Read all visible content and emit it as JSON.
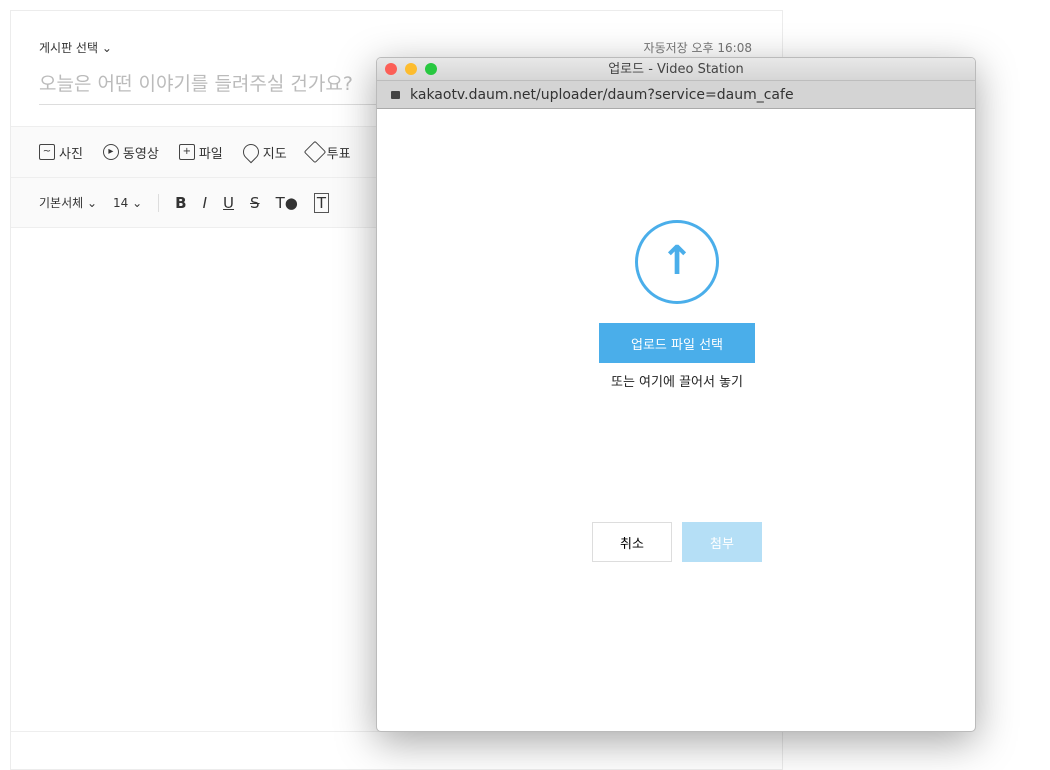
{
  "editor": {
    "board_select": "게시판 선택 ⌄",
    "autosave": "자동저장 오후 16:08",
    "title_placeholder": "오늘은 어떤 이야기를 들려주실 건가요?",
    "insert_toolbar": [
      {
        "label": "사진",
        "icon": "image-icon"
      },
      {
        "label": "동영상",
        "icon": "play-icon"
      },
      {
        "label": "파일",
        "icon": "file-plus-icon"
      },
      {
        "label": "지도",
        "icon": "map-pin-icon"
      },
      {
        "label": "투표",
        "icon": "vote-icon"
      }
    ],
    "font_family": "기본서체 ⌄",
    "font_size": "14  ⌄",
    "format": {
      "bold": "B",
      "italic": "I",
      "underline": "U",
      "strike": "S",
      "color": "T●",
      "bg": "T"
    }
  },
  "popup": {
    "title": "업로드 - Video Station",
    "url": "kakaotv.daum.net/uploader/daum?service=daum_cafe",
    "upload_button": "업로드 파일 선택",
    "drop_text": "또는 여기에 끌어서 놓기",
    "cancel": "취소",
    "attach": "첨부",
    "accent": "#4aaeea"
  }
}
